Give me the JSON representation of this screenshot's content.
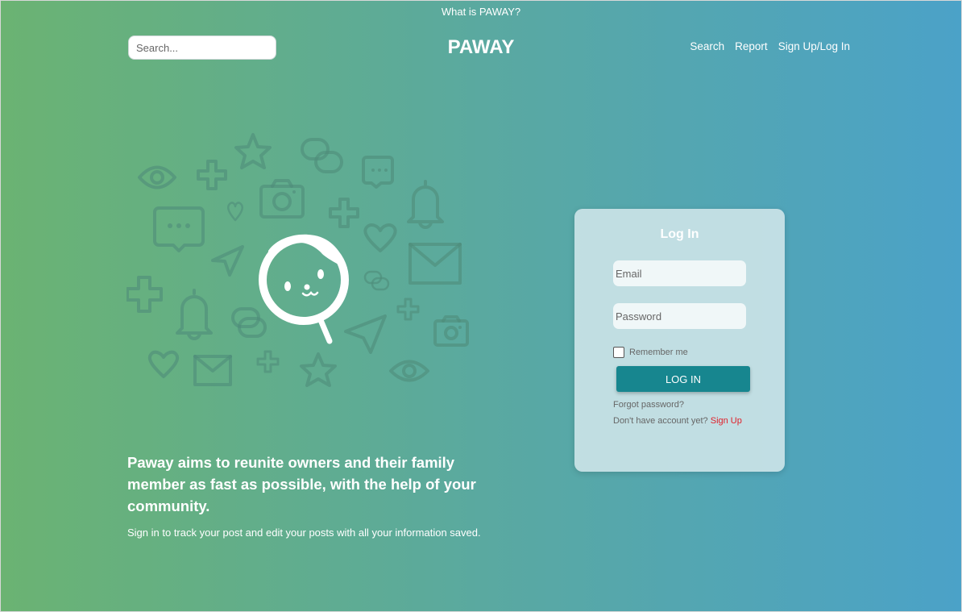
{
  "header": {
    "top_link": "What is PAWAY?",
    "search_placeholder": "Search...",
    "brand": "PAWAY",
    "nav": [
      "Search",
      "Report",
      "Sign Up/Log In"
    ]
  },
  "hero": {
    "headline": "Paway aims to reunite owners and their family member as fast as possible, with the help of your community.",
    "subline": "Sign in to track your post and edit your posts with all your information saved."
  },
  "login": {
    "title": "Log In",
    "email_placeholder": "Email",
    "password_placeholder": "Password",
    "remember_label": "Remember me",
    "button_label": "LOG IN",
    "forgot_label": "Forgot password?",
    "no_account_text": "Don't have account yet? ",
    "signup_label": "Sign Up"
  },
  "colors": {
    "gradient_left": "#6bb372",
    "gradient_right": "#4ba2c8",
    "button": "#17868f",
    "signup_link": "#e0202a"
  },
  "icons": [
    "eye-icon",
    "plus-icon",
    "star-icon",
    "link-icon",
    "chat-bubble-icon",
    "camera-icon",
    "heart-icon",
    "bell-icon",
    "send-icon",
    "mail-icon",
    "magnifier-cat-icon"
  ]
}
